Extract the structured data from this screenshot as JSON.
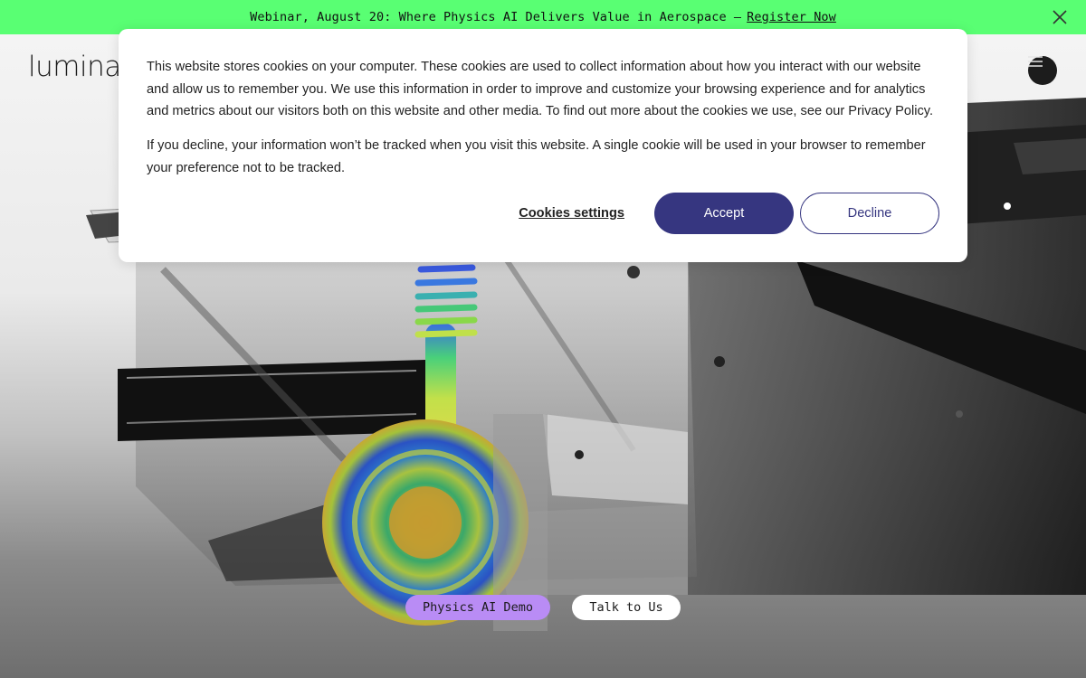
{
  "banner": {
    "text": "Webinar, August 20: Where Physics AI Delivers Value in Aerospace —",
    "link": "Register Now",
    "close_icon": "close-icon"
  },
  "header": {
    "logo": "lumina",
    "menu_icon": "hamburger-menu-icon"
  },
  "hero": {
    "image": "vehicle-chassis-simulation",
    "primary_cta": "Physics AI Demo",
    "secondary_cta": "Talk to Us",
    "colors": {
      "primary_cta_bg": "#b98cf5",
      "banner_bg": "#59ff73"
    }
  },
  "cookie_dialog": {
    "paragraph_1": "This website stores cookies on your computer. These cookies are used to collect information about how you interact with our website and allow us to remember you. We use this information in order to improve and customize your browsing experience and for analytics and metrics about our visitors both on this website and other media. To find out more about the cookies we use, see our Privacy Policy.",
    "paragraph_2": "If you decline, your information won’t be tracked when you visit this website. A single cookie will be used in your browser to remember your preference not to be tracked.",
    "settings_label": "Cookies settings",
    "accept_label": "Accept",
    "decline_label": "Decline",
    "accent_color": "#363680"
  }
}
